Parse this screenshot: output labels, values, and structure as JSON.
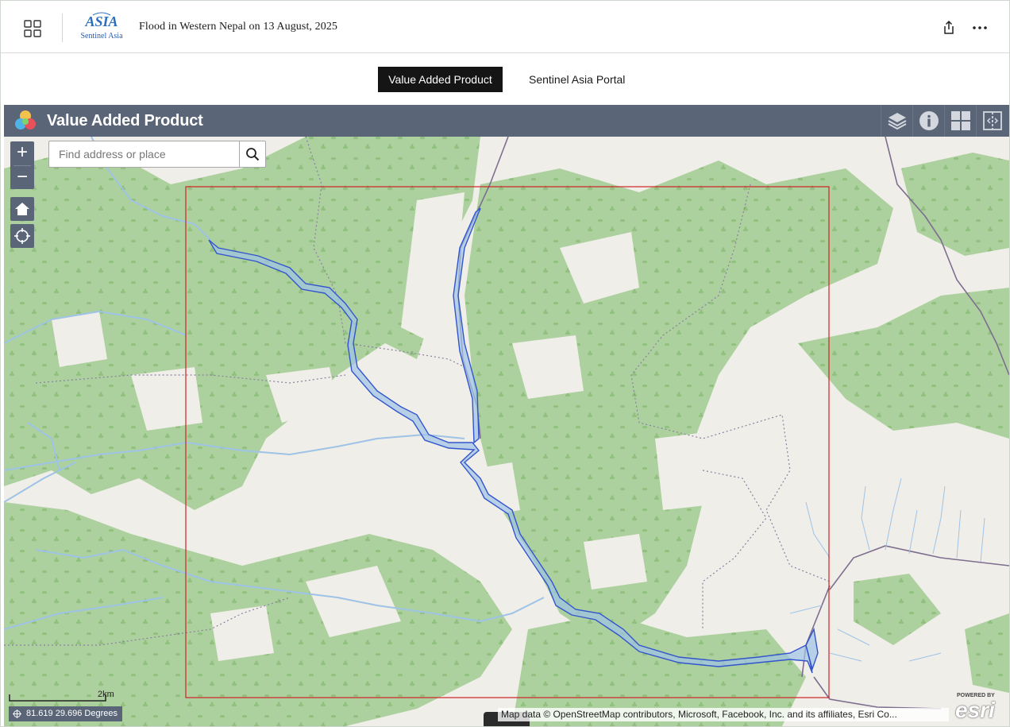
{
  "header": {
    "title": "Flood in Western Nepal on 13 August, 2025",
    "logo_text": "Sentinel Asia",
    "logo_mark": "ASIA"
  },
  "tabs": [
    {
      "label": "Value Added Product",
      "active": true
    },
    {
      "label": "Sentinel Asia Portal",
      "active": false
    }
  ],
  "appbar": {
    "title": "Value Added Product",
    "tools": [
      "layers-icon",
      "info-icon",
      "basemap-gallery-icon",
      "split-view-icon"
    ]
  },
  "map": {
    "search": {
      "placeholder": "Find address or place",
      "value": ""
    },
    "zoom_in": "+",
    "zoom_out": "−",
    "scale_label": "2km",
    "coordinates": "81.619 29.696 Degrees",
    "attribution": "Map data © OpenStreetMap contributors, Microsoft, Facebook, Inc. and its affiliates, Esri Co...",
    "esri_powered": "POWERED BY",
    "esri_logo": "esri",
    "colors": {
      "forest": "#add19e",
      "land": "#f0eee9",
      "river": "#9ec3e6",
      "flood_outline": "#3355cc",
      "aoi_box": "#cc2222",
      "boundary": "#8a7fa0"
    }
  }
}
